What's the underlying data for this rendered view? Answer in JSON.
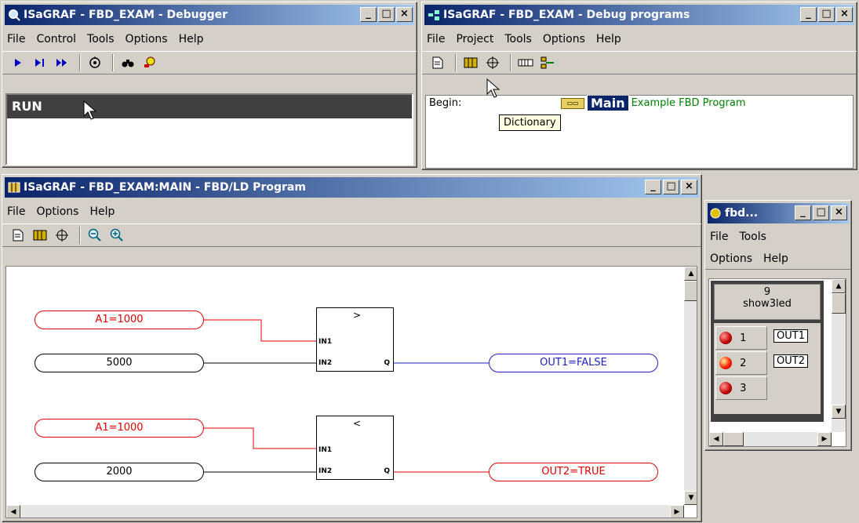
{
  "debugger": {
    "title": "ISaGRAF - FBD_EXAM - Debugger",
    "menu": [
      "File",
      "Control",
      "Tools",
      "Options",
      "Help"
    ],
    "status": "RUN"
  },
  "debug_programs": {
    "title": "ISaGRAF - FBD_EXAM - Debug programs",
    "menu": [
      "File",
      "Project",
      "Tools",
      "Options",
      "Help"
    ],
    "begin_label": "Begin:",
    "program_name": "Main",
    "program_desc": "Example FBD Program",
    "tooltip": "Dictionary"
  },
  "fbd": {
    "title": "ISaGRAF - FBD_EXAM:MAIN - FBD/LD Program",
    "menu": [
      "File",
      "Options",
      "Help"
    ],
    "rung1": {
      "in1": "A1=1000",
      "in2": "5000",
      "op": ">",
      "out": "OUT1=FALSE"
    },
    "rung2": {
      "in1": "A1=1000",
      "in2": "2000",
      "op": "<",
      "out": "OUT2=TRUE"
    },
    "pin_in1": "IN1",
    "pin_in2": "IN2",
    "pin_q": "Q"
  },
  "show": {
    "title": "fbd...",
    "menu1": [
      "File",
      "Tools"
    ],
    "menu2": [
      "Options",
      "Help"
    ],
    "count": "9",
    "name": "show3led",
    "leds": [
      {
        "num": "1",
        "label": "OUT1",
        "on": false
      },
      {
        "num": "2",
        "label": "OUT2",
        "on": true
      },
      {
        "num": "3",
        "label": "",
        "on": false
      }
    ]
  },
  "colors": {
    "titlebar": "#0a246a",
    "red_wire": "#e00000",
    "blue_wire": "#2020c0",
    "green_desc": "#008000",
    "selection": "#0a246a"
  }
}
